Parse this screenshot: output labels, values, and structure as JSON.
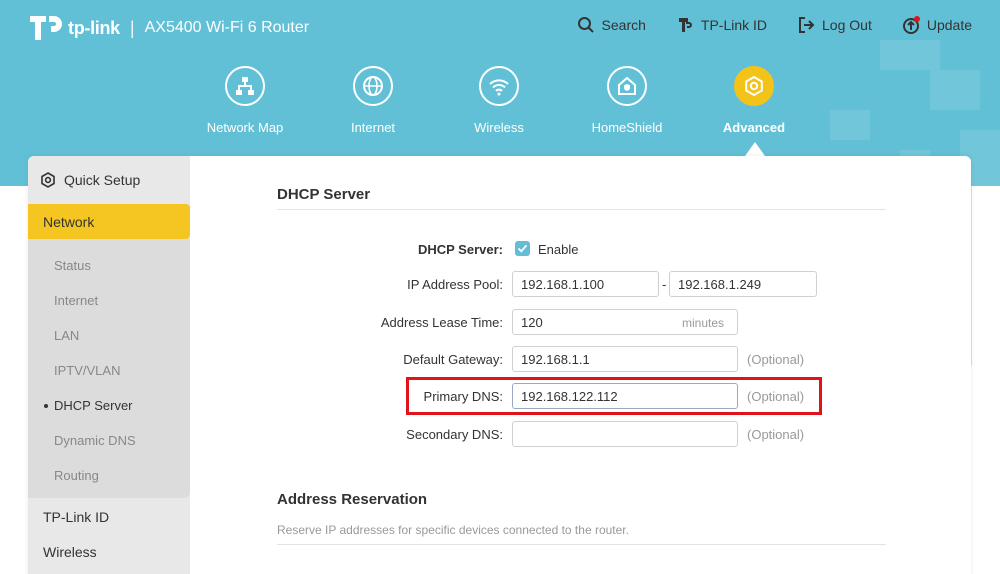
{
  "header": {
    "brand": "tp-link",
    "separator": "|",
    "model": "AX5400 Wi-Fi 6 Router",
    "actions": [
      {
        "label": "Search",
        "icon": "search-icon"
      },
      {
        "label": "TP-Link ID",
        "icon": "tplink-id-icon"
      },
      {
        "label": "Log Out",
        "icon": "logout-icon"
      },
      {
        "label": "Update",
        "icon": "update-icon"
      }
    ]
  },
  "nav": {
    "items": [
      {
        "label": "Network Map",
        "icon": "network-map-icon"
      },
      {
        "label": "Internet",
        "icon": "globe-icon"
      },
      {
        "label": "Wireless",
        "icon": "wifi-icon"
      },
      {
        "label": "HomeShield",
        "icon": "homeshield-icon"
      },
      {
        "label": "Advanced",
        "icon": "gear-icon",
        "active": true
      }
    ]
  },
  "sidebar": {
    "quick_setup": "Quick Setup",
    "network": "Network",
    "network_items": [
      "Status",
      "Internet",
      "LAN",
      "IPTV/VLAN",
      "DHCP Server",
      "Dynamic DNS",
      "Routing"
    ],
    "active_item": "DHCP Server",
    "tplink_id": "TP-Link ID",
    "wireless": "Wireless"
  },
  "dhcp": {
    "title": "DHCP Server",
    "server_label": "DHCP Server:",
    "enable_label": "Enable",
    "enabled": true,
    "pool_label": "IP Address Pool:",
    "pool_start": "192.168.1.100",
    "pool_dash": "-",
    "pool_end": "192.168.1.249",
    "lease_label": "Address Lease Time:",
    "lease_value": "120",
    "lease_unit": "minutes",
    "gateway_label": "Default Gateway:",
    "gateway_value": "192.168.1.1",
    "gateway_optional": "(Optional)",
    "primary_dns_label": "Primary DNS:",
    "primary_dns_value": "192.168.122.112",
    "primary_dns_optional": "(Optional)",
    "secondary_dns_label": "Secondary DNS:",
    "secondary_dns_value": "",
    "secondary_dns_optional": "(Optional)"
  },
  "reservation": {
    "title": "Address Reservation",
    "description": "Reserve IP addresses for specific devices connected to the router."
  },
  "colors": {
    "header_bg": "#62c0d6",
    "accent_yellow": "#f5c621",
    "highlight_red": "#e0121a",
    "checkbox_blue": "#64bcd6"
  }
}
